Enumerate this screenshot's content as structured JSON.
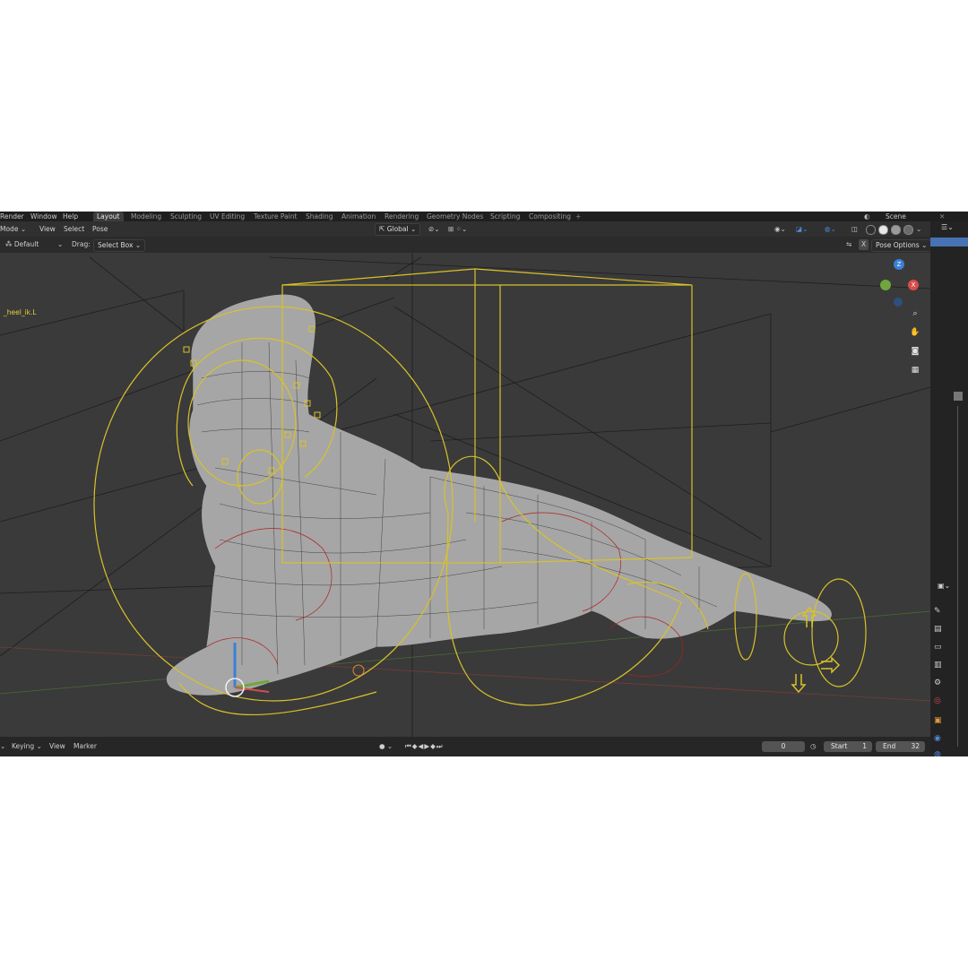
{
  "topbar": {
    "menus": [
      "Render",
      "Window",
      "Help"
    ],
    "workspace_tabs": [
      "Layout",
      "Modeling",
      "Sculpting",
      "UV Editing",
      "Texture Paint",
      "Shading",
      "Animation",
      "Rendering",
      "Geometry Nodes",
      "Scripting",
      "Compositing"
    ],
    "add_tab": "+",
    "scene_label": "Scene"
  },
  "header": {
    "mode": "Mode",
    "menus": [
      "View",
      "Select",
      "Pose"
    ],
    "orientation": "Global",
    "shading_modes": [
      "wireframe",
      "solid",
      "material",
      "rendered"
    ]
  },
  "tool_header": {
    "orientation_label": "Default",
    "drag_label": "Drag:",
    "drag_value": "Select Box",
    "pose_options": "Pose Options",
    "x_label": "X"
  },
  "viewport": {
    "active_bone_label": "_heel_ik.L",
    "gizmo_axes": [
      "Z",
      "Y",
      "X"
    ],
    "nav_icons": [
      "zoom-icon",
      "hand-icon",
      "camera-icon",
      "grid-icon"
    ]
  },
  "timeline": {
    "menus": [
      "Keying",
      "View",
      "Marker"
    ],
    "current_frame": "0",
    "start_label": "Start",
    "start_value": "1",
    "end_label": "End",
    "end_value": "32"
  },
  "colors": {
    "bone_outline": "#d8c22a",
    "active_bone": "#e6d33c",
    "mesh_wire": "#1e1e1e",
    "deform_curve": "#b02020",
    "axis_x": "#d84c4c",
    "axis_y": "#6fa63e",
    "axis_z": "#3b7fd6",
    "accent": "#4772b3"
  }
}
